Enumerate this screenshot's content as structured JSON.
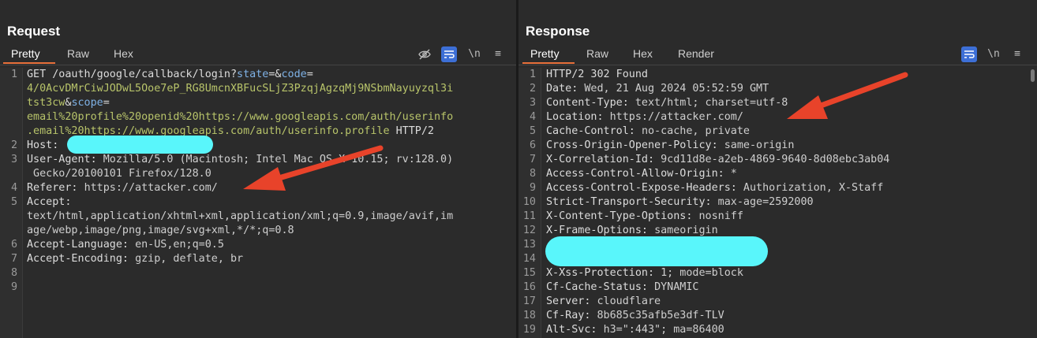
{
  "request": {
    "title": "Request",
    "tabs": [
      "Pretty",
      "Raw",
      "Hex"
    ],
    "active_tab": "Pretty",
    "lines": [
      {
        "n": "1",
        "rows": [
          [
            [
              "k",
              "GET /oauth/google/callback/login?"
            ],
            [
              "pn",
              "state"
            ],
            [
              "k",
              "=&"
            ],
            [
              "pn",
              "code"
            ],
            [
              "k",
              "="
            ]
          ],
          [
            [
              "pv",
              "4/0AcvDMrCiwJODwL5Ooe7eP_RG8UmcnXBFucSLjZ3PzqjAgzqMj9NSbmNayuyzql3i"
            ]
          ],
          [
            [
              "pv",
              "tst3cw"
            ],
            [
              "k",
              "&"
            ],
            [
              "pn",
              "scope"
            ],
            [
              "k",
              "="
            ]
          ],
          [
            [
              "pv",
              "email%20profile%20openid%20https://www.googleapis.com/auth/userinfo"
            ]
          ],
          [
            [
              "pv",
              ".email%20https://www.googleapis.com/auth/userinfo.profile"
            ],
            [
              "k",
              " HTTP/2"
            ]
          ]
        ]
      },
      {
        "n": "2",
        "rows": [
          [
            [
              "k",
              "Host: "
            ]
          ]
        ]
      },
      {
        "n": "3",
        "rows": [
          [
            [
              "k",
              "User-Agent: "
            ],
            [
              "hv",
              "Mozilla/5.0 (Macintosh; Intel Mac OS X 10.15; rv:128.0)"
            ]
          ],
          [
            [
              "hv",
              " Gecko/20100101 Firefox/128.0"
            ]
          ]
        ]
      },
      {
        "n": "4",
        "rows": [
          [
            [
              "k",
              "Referer: "
            ],
            [
              "hv",
              "https://attacker.com/"
            ]
          ]
        ]
      },
      {
        "n": "5",
        "rows": [
          [
            [
              "k",
              "Accept:"
            ]
          ],
          [
            [
              "hv",
              "text/html,application/xhtml+xml,application/xml;q=0.9,image/avif,im"
            ]
          ],
          [
            [
              "hv",
              "age/webp,image/png,image/svg+xml,*/*;q=0.8"
            ]
          ]
        ]
      },
      {
        "n": "6",
        "rows": [
          [
            [
              "k",
              "Accept-Language: "
            ],
            [
              "hv",
              "en-US,en;q=0.5"
            ]
          ]
        ]
      },
      {
        "n": "7",
        "rows": [
          [
            [
              "k",
              "Accept-Encoding: "
            ],
            [
              "hv",
              "gzip, deflate, br"
            ]
          ]
        ]
      },
      {
        "n": "8",
        "rows": [
          [
            [
              "k",
              ""
            ]
          ]
        ]
      },
      {
        "n": "9",
        "rows": [
          [
            [
              "k",
              ""
            ]
          ]
        ]
      }
    ]
  },
  "response": {
    "title": "Response",
    "tabs": [
      "Pretty",
      "Raw",
      "Hex",
      "Render"
    ],
    "active_tab": "Pretty",
    "lines": [
      {
        "n": "1",
        "rows": [
          [
            [
              "k",
              "HTTP/2 302 Found"
            ]
          ]
        ]
      },
      {
        "n": "2",
        "rows": [
          [
            [
              "k",
              "Date: "
            ],
            [
              "hv",
              "Wed, 21 Aug 2024 05:52:59 GMT"
            ]
          ]
        ]
      },
      {
        "n": "3",
        "rows": [
          [
            [
              "k",
              "Content-Type: "
            ],
            [
              "hv",
              "text/html; charset=utf-8"
            ]
          ]
        ]
      },
      {
        "n": "4",
        "rows": [
          [
            [
              "k",
              "Location: "
            ],
            [
              "hv",
              "https://attacker.com/"
            ]
          ]
        ]
      },
      {
        "n": "5",
        "rows": [
          [
            [
              "k",
              "Cache-Control: "
            ],
            [
              "hv",
              "no-cache, private"
            ]
          ]
        ]
      },
      {
        "n": "6",
        "rows": [
          [
            [
              "k",
              "Cross-Origin-Opener-Policy: "
            ],
            [
              "hv",
              "same-origin"
            ]
          ]
        ]
      },
      {
        "n": "7",
        "rows": [
          [
            [
              "k",
              "X-Correlation-Id: "
            ],
            [
              "hv",
              "9cd11d8e-a2eb-4869-9640-8d08ebc3ab04"
            ]
          ]
        ]
      },
      {
        "n": "8",
        "rows": [
          [
            [
              "k",
              "Access-Control-Allow-Origin: "
            ],
            [
              "hv",
              "*"
            ]
          ]
        ]
      },
      {
        "n": "9",
        "rows": [
          [
            [
              "k",
              "Access-Control-Expose-Headers: "
            ],
            [
              "hv",
              "Authorization, X-Staff"
            ]
          ]
        ]
      },
      {
        "n": "10",
        "rows": [
          [
            [
              "k",
              "Strict-Transport-Security: "
            ],
            [
              "hv",
              "max-age=2592000"
            ]
          ]
        ]
      },
      {
        "n": "11",
        "rows": [
          [
            [
              "k",
              "X-Content-Type-Options: "
            ],
            [
              "hv",
              "nosniff"
            ]
          ]
        ]
      },
      {
        "n": "12",
        "rows": [
          [
            [
              "k",
              "X-Frame-Options: "
            ],
            [
              "hv",
              "sameorigin"
            ]
          ]
        ]
      },
      {
        "n": "13",
        "rows": [
          [
            [
              "k",
              ""
            ]
          ]
        ]
      },
      {
        "n": "14",
        "rows": [
          [
            [
              "k",
              ""
            ]
          ]
        ]
      },
      {
        "n": "15",
        "rows": [
          [
            [
              "k",
              "X-Xss-Protection: "
            ],
            [
              "hv",
              "1; mode=block"
            ]
          ]
        ]
      },
      {
        "n": "16",
        "rows": [
          [
            [
              "k",
              "Cf-Cache-Status: "
            ],
            [
              "hv",
              "DYNAMIC"
            ]
          ]
        ]
      },
      {
        "n": "17",
        "rows": [
          [
            [
              "k",
              "Server: "
            ],
            [
              "hv",
              "cloudflare"
            ]
          ]
        ]
      },
      {
        "n": "18",
        "rows": [
          [
            [
              "k",
              "Cf-Ray: "
            ],
            [
              "hv",
              "8b685c35afb5e3df-TLV"
            ]
          ]
        ]
      },
      {
        "n": "19",
        "rows": [
          [
            [
              "k",
              "Alt-Svc: "
            ],
            [
              "hv",
              "h3=\":443\"; ma=86400"
            ]
          ]
        ]
      }
    ]
  },
  "toolbar": {
    "newline_label": "\\n",
    "menu_label": "≡",
    "icons": [
      "eye-off-icon",
      "wrap-icon",
      "newline-icon",
      "menu-icon"
    ]
  },
  "layout_buttons": [
    "split-vertical-icon",
    "split-horizontal-icon",
    "single-pane-icon"
  ],
  "colors": {
    "accent": "#3d6fd6",
    "tab_underline": "#e8703a",
    "param_name": "#7fb2e6",
    "param_value": "#b8c46a",
    "redaction": "#59f6fb",
    "arrow": "#e8432a"
  }
}
